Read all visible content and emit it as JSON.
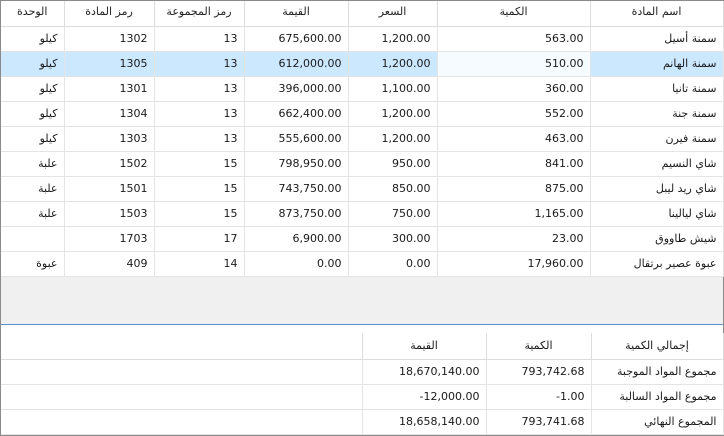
{
  "grid": {
    "headers": {
      "unit": "الوحدة",
      "item_code": "رمز المادة",
      "group_code": "رمز المجموعة",
      "value": "القيمة",
      "price": "السعر",
      "quantity": "الكمية",
      "item_name": "اسم المادة"
    },
    "rows": [
      {
        "unit": "كيلو",
        "item_code": "1302",
        "group_code": "13",
        "value": "675,600.00",
        "price": "1,200.00",
        "quantity": "563.00",
        "item_name": "سمنة أسيل"
      },
      {
        "unit": "كيلو",
        "item_code": "1305",
        "group_code": "13",
        "value": "612,000.00",
        "price": "1,200.00",
        "quantity": "510.00",
        "item_name": "سمنة الهانم"
      },
      {
        "unit": "كيلو",
        "item_code": "1301",
        "group_code": "13",
        "value": "396,000.00",
        "price": "1,100.00",
        "quantity": "360.00",
        "item_name": "سمنة تانيا"
      },
      {
        "unit": "كيلو",
        "item_code": "1304",
        "group_code": "13",
        "value": "662,400.00",
        "price": "1,200.00",
        "quantity": "552.00",
        "item_name": "سمنة جنة"
      },
      {
        "unit": "كيلو",
        "item_code": "1303",
        "group_code": "13",
        "value": "555,600.00",
        "price": "1,200.00",
        "quantity": "463.00",
        "item_name": "سمنة فيرن"
      },
      {
        "unit": "علبة",
        "item_code": "1502",
        "group_code": "15",
        "value": "798,950.00",
        "price": "950.00",
        "quantity": "841.00",
        "item_name": "شاي النسيم"
      },
      {
        "unit": "علبة",
        "item_code": "1501",
        "group_code": "15",
        "value": "743,750.00",
        "price": "850.00",
        "quantity": "875.00",
        "item_name": "شاي ريد ليبل"
      },
      {
        "unit": "علبة",
        "item_code": "1503",
        "group_code": "15",
        "value": "873,750.00",
        "price": "750.00",
        "quantity": "1,165.00",
        "item_name": "شاي ليالينا"
      },
      {
        "unit": "",
        "item_code": "1703",
        "group_code": "17",
        "value": "6,900.00",
        "price": "300.00",
        "quantity": "23.00",
        "item_name": "شيش طاووق"
      },
      {
        "unit": "عبوة",
        "item_code": "409",
        "group_code": "14",
        "value": "0.00",
        "price": "0.00",
        "quantity": "17,960.00",
        "item_name": "عبوة عصير برتقال"
      }
    ],
    "selected_row_index": 1
  },
  "summary": {
    "headers": {
      "value": "القيمة",
      "quantity": "الكمية",
      "total_label": "إجمالي الكمية"
    },
    "rows": [
      {
        "label": "مجموع المواد الموجبة",
        "quantity": "793,742.68",
        "value": "18,670,140.00"
      },
      {
        "label": "مجموع المواد السالبة",
        "quantity": "-1.00",
        "value": "-12,000.00"
      },
      {
        "label": "المجموع النهائي",
        "quantity": "793,741.68",
        "value": "18,658,140.00"
      }
    ]
  },
  "colors": {
    "selection": "#cce8ff",
    "separator": "#5a8fc9"
  }
}
